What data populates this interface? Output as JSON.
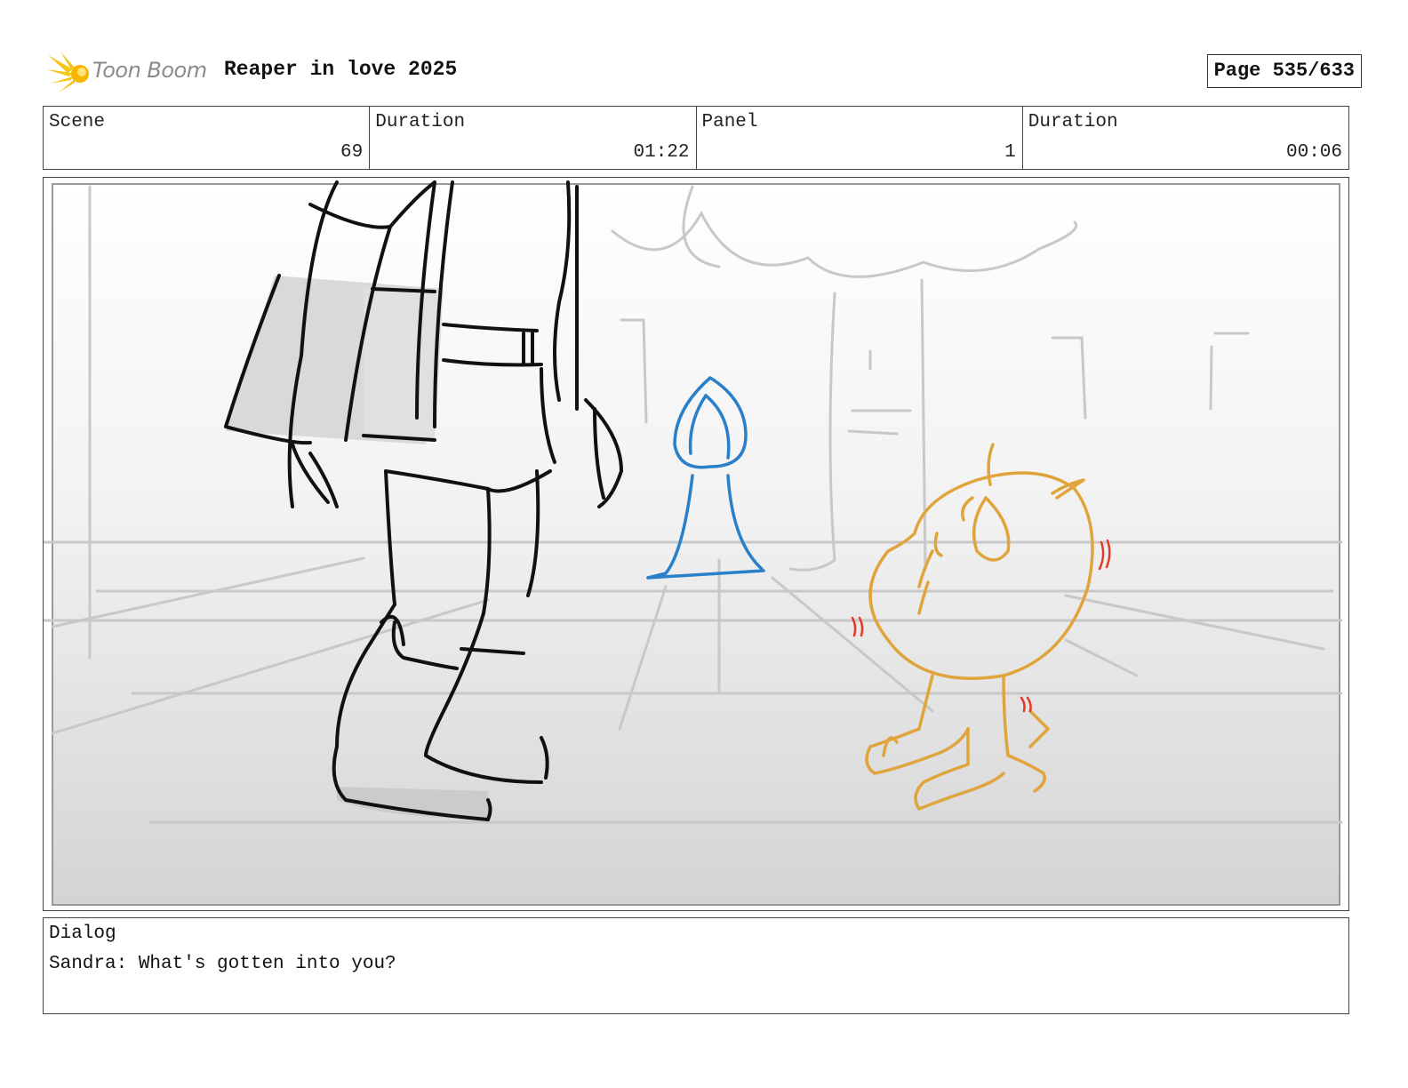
{
  "header": {
    "logo_text": "Toon Boom",
    "project_title": "Reaper in love 2025",
    "page_label": "Page 535/633"
  },
  "info": {
    "scene_label": "Scene",
    "scene_value": "69",
    "scene_duration_label": "Duration",
    "scene_duration_value": "01:22",
    "panel_label": "Panel",
    "panel_value": "1",
    "panel_duration_label": "Duration",
    "panel_duration_value": "00:06"
  },
  "dialog": {
    "label": "Dialog",
    "text": "Sandra: What's gotten into you?"
  },
  "colors": {
    "logo_yellow": "#f5c518",
    "figure_blue": "#2a7fc9",
    "creature_orange": "#e0a43c",
    "accent_red": "#e23b2a"
  }
}
